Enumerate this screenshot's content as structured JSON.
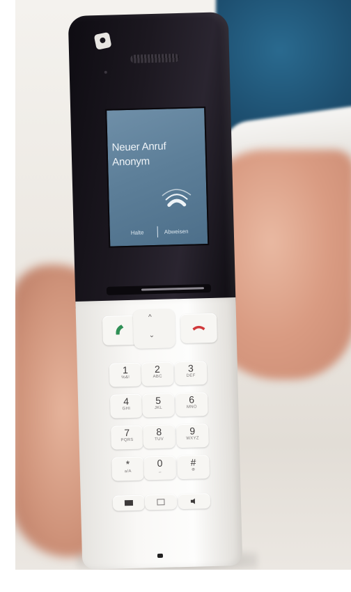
{
  "screen": {
    "line1": "Neuer Anruf",
    "line2": "Anonym",
    "softkey_left": "Halte",
    "softkey_right": "Abweisen"
  },
  "keypad": {
    "keys": [
      {
        "num": "1",
        "sub": "%&!"
      },
      {
        "num": "2",
        "sub": "ABC"
      },
      {
        "num": "3",
        "sub": "DEF"
      },
      {
        "num": "4",
        "sub": "GHI"
      },
      {
        "num": "5",
        "sub": "JKL"
      },
      {
        "num": "6",
        "sub": "MNO"
      },
      {
        "num": "7",
        "sub": "PQRS"
      },
      {
        "num": "8",
        "sub": "TUV"
      },
      {
        "num": "9",
        "sub": "WXYZ"
      },
      {
        "num": "*",
        "sub": "a/A"
      },
      {
        "num": "0",
        "sub": "_"
      },
      {
        "num": "#",
        "sub": "⊕"
      }
    ],
    "nav_up": "^",
    "nav_down": "⌄"
  },
  "colors": {
    "screen": "#5d7f99",
    "call_green": "#2f8f55",
    "end_red": "#d0383a"
  },
  "icons": [
    "ringing-handset-icon",
    "call-icon",
    "end-call-icon",
    "envelope-icon",
    "menu-icon",
    "speaker-icon"
  ]
}
